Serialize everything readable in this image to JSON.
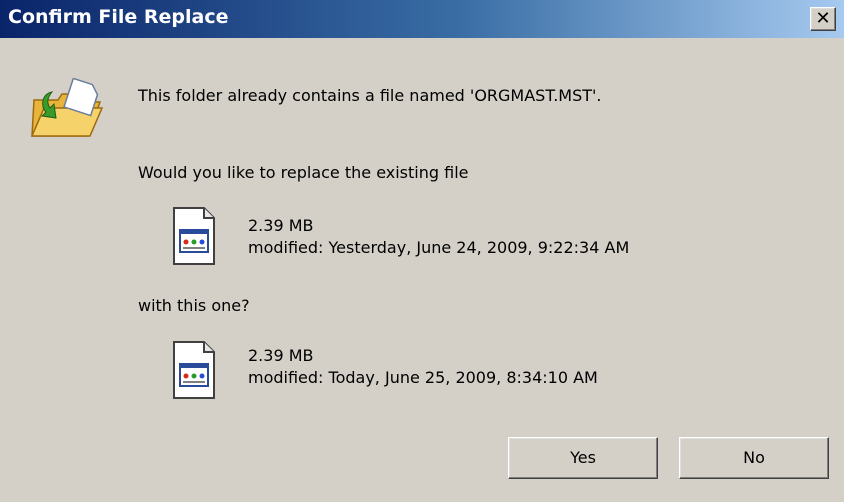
{
  "window": {
    "title": "Confirm File Replace",
    "close_glyph": "✕"
  },
  "message": {
    "line1": "This folder already contains a file named 'ORGMAST.MST'.",
    "line2": "Would you like to replace the existing file",
    "line3": "with this one?"
  },
  "existing_file": {
    "size": "2.39 MB",
    "modified": "modified: Yesterday, June 24, 2009, 9:22:34 AM",
    "icon": "file-icon"
  },
  "new_file": {
    "size": "2.39 MB",
    "modified": "modified: Today, June 25, 2009, 8:34:10 AM",
    "icon": "file-icon"
  },
  "buttons": {
    "yes": "Yes",
    "no": "No"
  },
  "colors": {
    "titlebar_start": "#0a246a",
    "titlebar_end": "#a6caf0",
    "dialog_bg": "#d4d0c8"
  }
}
